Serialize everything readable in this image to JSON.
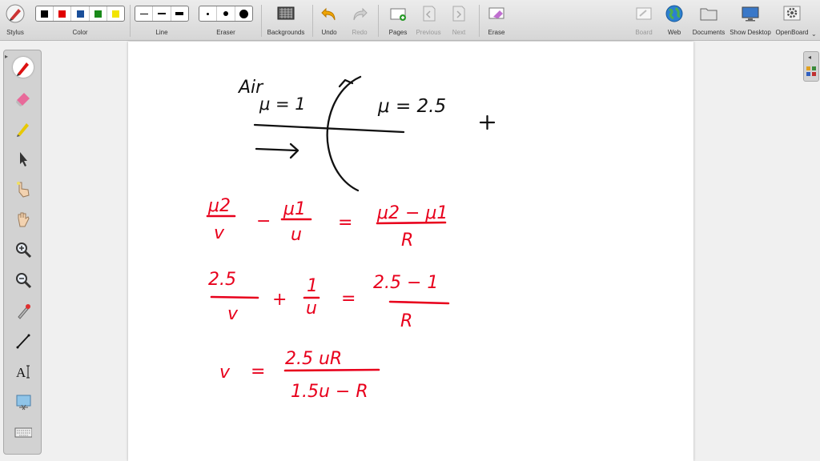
{
  "toolbar": {
    "stylus_label": "Stylus",
    "color_label": "Color",
    "line_label": "Line",
    "eraser_label": "Eraser",
    "backgrounds_label": "Backgrounds",
    "undo_label": "Undo",
    "redo_label": "Redo",
    "pages_label": "Pages",
    "previous_label": "Previous",
    "next_label": "Next",
    "erase_label": "Erase",
    "board_label": "Board",
    "web_label": "Web",
    "documents_label": "Documents",
    "show_desktop_label": "Show Desktop",
    "openboard_label": "OpenBoard",
    "colors": [
      "#000000",
      "#e00000",
      "#1a4f9a",
      "#1a8a1a",
      "#f2e400"
    ]
  },
  "canvas": {
    "ink_black": "#111111",
    "ink_red": "#e8001c",
    "medium1": "Air",
    "mu1": "μ = 1",
    "mu2": "μ = 2.5",
    "eq1_left_num": "μ2",
    "eq1_left_den": "v",
    "eq1_op": "−",
    "eq1_mid_num": "μ1",
    "eq1_mid_den": "u",
    "eq1_eq": "=",
    "eq1_right_num": "μ2 − μ1",
    "eq1_right_den": "R",
    "eq2_left_num": "2.5",
    "eq2_left_den": "v",
    "eq2_op": "+",
    "eq2_mid_num": "1",
    "eq2_mid_den": "u",
    "eq2_eq": "=",
    "eq2_right_num": "2.5 − 1",
    "eq2_right_den": "R",
    "eq3_lhs": "v",
    "eq3_eq": "=",
    "eq3_num": "2.5 uR",
    "eq3_den": "1.5u − R"
  }
}
